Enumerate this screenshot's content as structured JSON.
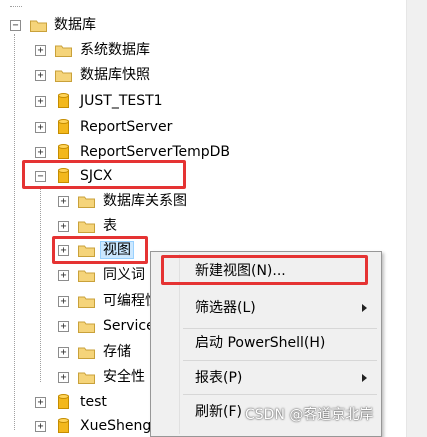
{
  "tree": {
    "root": {
      "label": "数据库",
      "expander": "−"
    },
    "items": [
      {
        "label": "系统数据库",
        "expander": "+",
        "icon": "folder-icon"
      },
      {
        "label": "数据库快照",
        "expander": "+",
        "icon": "folder-icon"
      },
      {
        "label": "JUST_TEST1",
        "expander": "+",
        "icon": "database-icon"
      },
      {
        "label": "ReportServer",
        "expander": "+",
        "icon": "database-icon"
      },
      {
        "label": "ReportServerTempDB",
        "expander": "+",
        "icon": "database-icon"
      },
      {
        "label": "SJCX",
        "expander": "−",
        "icon": "database-icon"
      }
    ],
    "sjcx_children": [
      {
        "label": "数据库关系图",
        "expander": "+"
      },
      {
        "label": "表",
        "expander": "+"
      },
      {
        "label": "视图",
        "expander": "+"
      },
      {
        "label": "同义词",
        "expander": "+"
      },
      {
        "label": "可编程性",
        "expander": "+"
      },
      {
        "label": "Service",
        "expander": "+"
      },
      {
        "label": "存储",
        "expander": "+"
      },
      {
        "label": "安全性",
        "expander": "+"
      }
    ],
    "after": [
      {
        "label": "test",
        "expander": "+",
        "icon": "database-icon"
      },
      {
        "label": "XueShengXinXi",
        "expander": "+",
        "icon": "database-icon"
      }
    ]
  },
  "context_menu": {
    "items": [
      {
        "label": "新建视图(N)...",
        "submenu": false
      },
      {
        "label": "筛选器(L)",
        "submenu": true
      },
      {
        "label": "启动 PowerShell(H)",
        "submenu": false
      },
      {
        "label": "报表(P)",
        "submenu": true
      },
      {
        "label": "刷新(F)",
        "submenu": false
      }
    ]
  },
  "watermark": "CSDN @客道京北岸",
  "colors": {
    "highlight_box": "#e53333",
    "folder": "#e8c25a",
    "database": "#f0b400",
    "selection": "#cce8ff"
  }
}
